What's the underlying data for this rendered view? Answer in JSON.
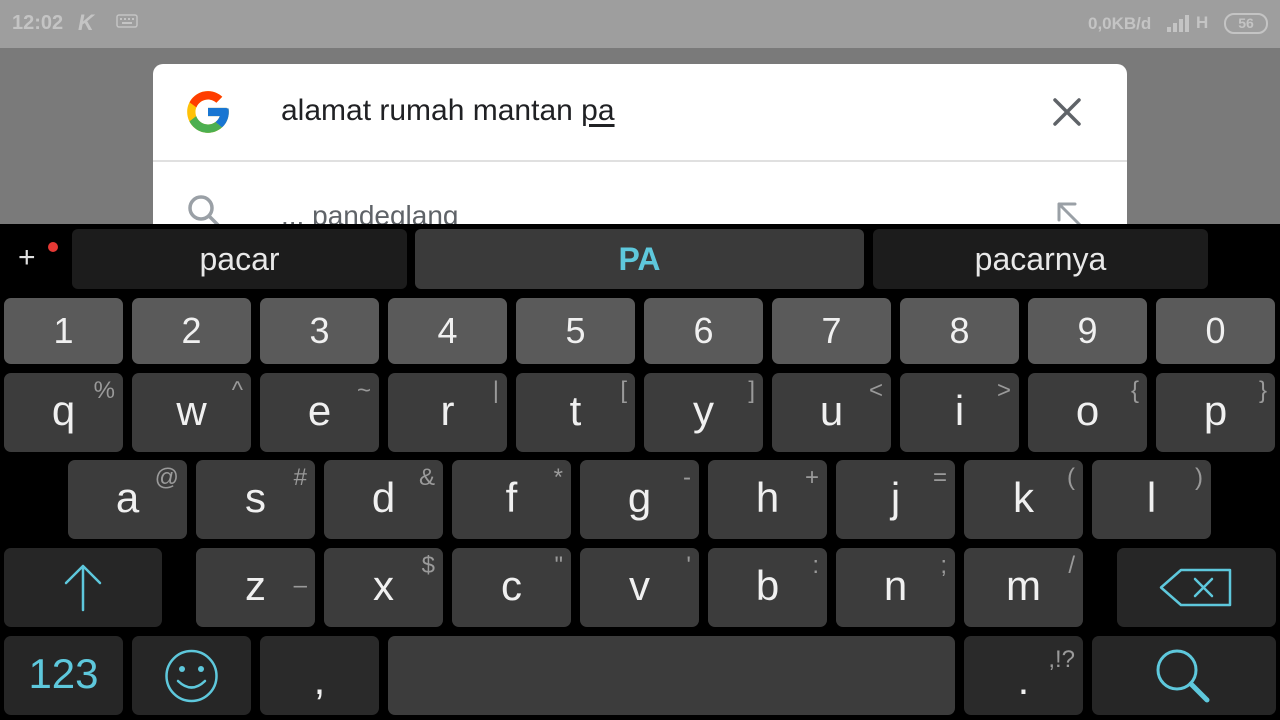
{
  "status_bar": {
    "time": "12:02",
    "k_glyph": "K",
    "network_speed": "0,0KB/d",
    "network_type": "H",
    "battery": "56"
  },
  "search": {
    "query_prefix": "alamat rumah mantan ",
    "query_composing": "pa",
    "suggestion": "... pandeglang"
  },
  "keyboard": {
    "add_label": "+",
    "candidates": [
      "pacar",
      "PA",
      "pacarnya"
    ],
    "number_row": [
      "1",
      "2",
      "3",
      "4",
      "5",
      "6",
      "7",
      "8",
      "9",
      "0"
    ],
    "row_q": [
      {
        "k": "q",
        "a": "%"
      },
      {
        "k": "w",
        "a": "^"
      },
      {
        "k": "e",
        "a": "~"
      },
      {
        "k": "r",
        "a": "|"
      },
      {
        "k": "t",
        "a": "["
      },
      {
        "k": "y",
        "a": "]"
      },
      {
        "k": "u",
        "a": "<"
      },
      {
        "k": "i",
        "a": ">"
      },
      {
        "k": "o",
        "a": "{"
      },
      {
        "k": "p",
        "a": "}"
      }
    ],
    "row_a": [
      {
        "k": "a",
        "a": "@"
      },
      {
        "k": "s",
        "a": "#"
      },
      {
        "k": "d",
        "a": "&"
      },
      {
        "k": "f",
        "a": "*"
      },
      {
        "k": "g",
        "a": "-"
      },
      {
        "k": "h",
        "a": "+"
      },
      {
        "k": "j",
        "a": "="
      },
      {
        "k": "k",
        "a": "("
      },
      {
        "k": "l",
        "a": ")"
      }
    ],
    "row_z": [
      {
        "k": "z",
        "a": "–"
      },
      {
        "k": "x",
        "a": "$"
      },
      {
        "k": "c",
        "a": "\""
      },
      {
        "k": "v",
        "a": "'"
      },
      {
        "k": "b",
        "a": ":"
      },
      {
        "k": "n",
        "a": ";"
      },
      {
        "k": "m",
        "a": "/"
      }
    ],
    "symbols_key": "123",
    "comma_key": ",",
    "period_key": ".",
    "period_alt": ",!?"
  },
  "colors": {
    "accent": "#5ec8dc",
    "key_bg": "#3c3c3c",
    "number_key_bg": "#5a5a5a"
  }
}
